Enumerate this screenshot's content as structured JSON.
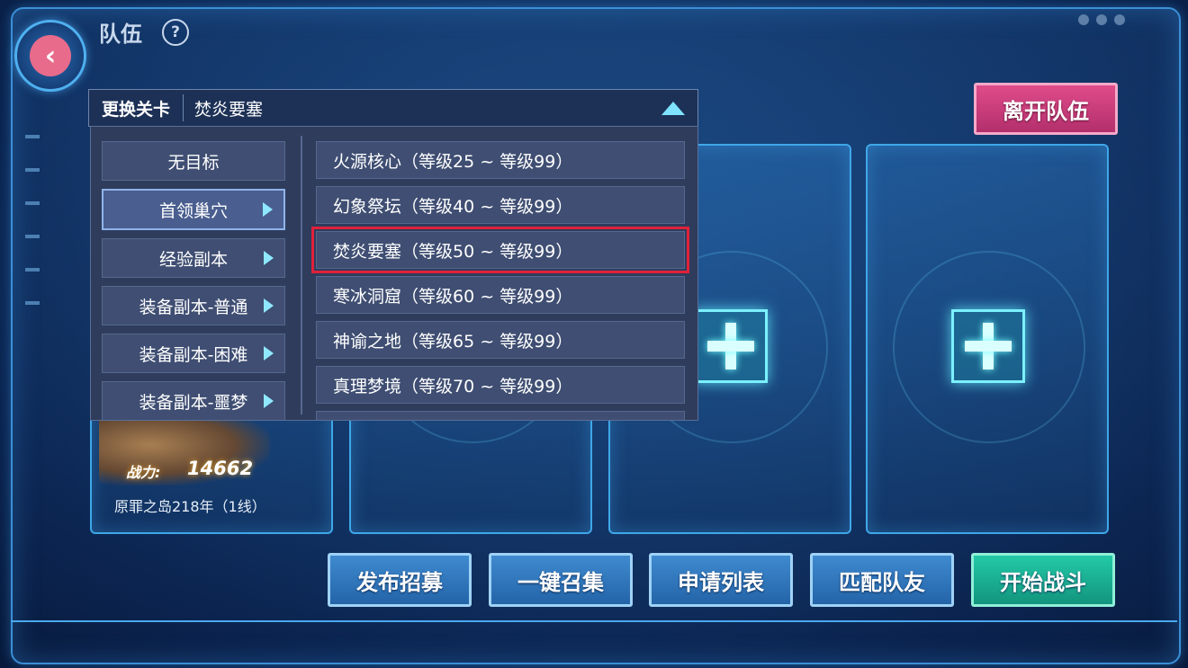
{
  "header": {
    "title": "队伍",
    "help_icon": "?"
  },
  "leave_button": "离开队伍",
  "selector": {
    "label": "更换关卡",
    "value": "焚炎要塞"
  },
  "categories": [
    {
      "label": "无目标",
      "has_arrow": false
    },
    {
      "label": "首领巢穴",
      "has_arrow": true,
      "active": true
    },
    {
      "label": "经验副本",
      "has_arrow": true
    },
    {
      "label": "装备副本-普通",
      "has_arrow": true
    },
    {
      "label": "装备副本-困难",
      "has_arrow": true
    },
    {
      "label": "装备副本-噩梦",
      "has_arrow": true
    }
  ],
  "stages": [
    {
      "label": "火源核心（等级25 ~ 等级99）"
    },
    {
      "label": "幻象祭坛（等级40 ~ 等级99）"
    },
    {
      "label": "焚炎要塞（等级50 ~ 等级99）",
      "selected": true
    },
    {
      "label": "寒冰洞窟（等级60 ~ 等级99）"
    },
    {
      "label": "神谕之地（等级65 ~ 等级99）"
    },
    {
      "label": "真理梦境（等级70 ~ 等级99）"
    }
  ],
  "member": {
    "power_label": "战力:",
    "power_value": "14662",
    "location": "原罪之岛218年（1线）"
  },
  "actions": {
    "recruit": "发布招募",
    "summon": "一键召集",
    "requests": "申请列表",
    "match": "匹配队友",
    "start": "开始战斗"
  },
  "colors": {
    "accent": "#3ea7e8",
    "leave": "#d03f7c",
    "start": "#1fb394",
    "highlight": "#e0213a"
  }
}
